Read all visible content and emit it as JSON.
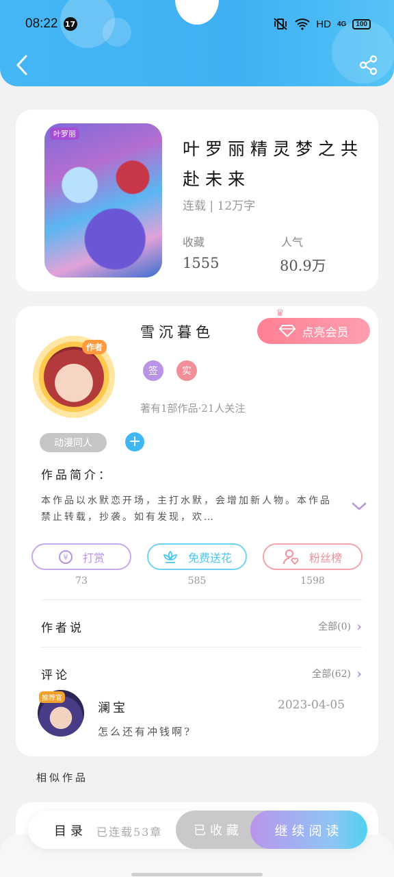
{
  "status_bar": {
    "time": "08:22",
    "notification_count": "17",
    "network": "HD",
    "cellular": "4G",
    "battery": "100"
  },
  "book": {
    "cover_badge": "叶罗丽",
    "title": "叶罗丽精灵梦之共赴未来",
    "serial_status": "连载 | 12万字",
    "collect_label": "收藏",
    "collect_value": "1555",
    "popularity_label": "人气",
    "popularity_value": "80.9万"
  },
  "author": {
    "tag": "作者",
    "name": "雪沉暮色",
    "vip_button": "点亮会员",
    "badge_sign": "签",
    "badge_real": "实",
    "meta": "著有1部作品·21人关注",
    "category_tag": "动漫同人",
    "add_tag": "+"
  },
  "intro": {
    "title": "作品简介：",
    "text": "本作品以水默恋开场，主打水默，会增加新人物。本作品禁止转载，抄袭。如有发现，欢…"
  },
  "actions": [
    {
      "label": "打赏",
      "count": "73",
      "color": "#b993e6"
    },
    {
      "label": "免费送花",
      "count": "585",
      "color": "#4cc6ee"
    },
    {
      "label": "粉丝榜",
      "count": "1598",
      "color": "#f08f97"
    }
  ],
  "author_says": {
    "title": "作者说",
    "all": "全部(0)"
  },
  "comments": {
    "title": "评论",
    "all": "全部(62)",
    "items": [
      {
        "badge": "推荐官",
        "user": "澜宝",
        "text": "怎么还有冲钱啊?",
        "date": "2023-04-05"
      }
    ]
  },
  "similar": {
    "title": "相似作品"
  },
  "bottom_bar": {
    "catalog": "目录",
    "status": "已连载53章",
    "collected": "已收藏",
    "read": "继续阅读"
  }
}
